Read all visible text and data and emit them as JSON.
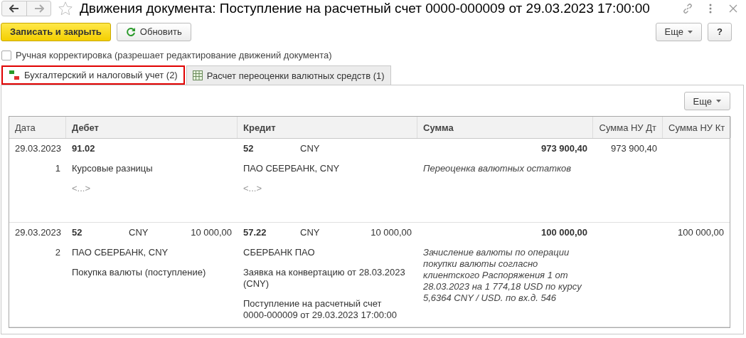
{
  "window": {
    "title": "Движения документа: Поступление на расчетный счет 0000-000009 от 29.03.2023 17:00:00"
  },
  "toolbar": {
    "primary": "Записать и закрыть",
    "refresh": "Обновить",
    "more": "Еще",
    "help": "?"
  },
  "manual_edit": {
    "label": "Ручная корректировка (разрешает редактирование движений документа)",
    "checked": false
  },
  "tabs": [
    {
      "label": "Бухгалтерский и налоговый учет (2)",
      "kind": "ledger",
      "selected": true
    },
    {
      "label": "Расчет переоценки валютных средств (1)",
      "kind": "table",
      "selected": false
    }
  ],
  "panel_more": "Еще",
  "table": {
    "columns": [
      "Дата",
      "Дебет",
      "Кредит",
      "Сумма",
      "Сумма НУ Дт",
      "Сумма НУ Кт"
    ],
    "rows": [
      {
        "date": "29.03.2023",
        "number": "1",
        "debit": {
          "account": "91.02",
          "subconto": [
            {
              "text": "Курсовые разницы",
              "empty": false
            },
            {
              "text": "<...>",
              "empty": true
            }
          ]
        },
        "credit": {
          "account": "52",
          "currency": "CNY",
          "subconto": [
            {
              "text": "ПАО СБЕРБАНК, CNY",
              "empty": false
            },
            {
              "text": "<...>",
              "empty": true
            }
          ]
        },
        "amount": "973 900,40",
        "description": "Переоценка валютных остатков",
        "amount_nu_dt": "973 900,40"
      },
      {
        "date": "29.03.2023",
        "number": "2",
        "debit": {
          "account": "52",
          "currency": "CNY",
          "currency_amount": "10 000,00",
          "subconto": [
            {
              "text": "ПАО СБЕРБАНК, CNY",
              "empty": false
            },
            {
              "text": "Покупка валюты (поступление)",
              "empty": false
            }
          ]
        },
        "credit": {
          "account": "57.22",
          "currency": "CNY",
          "currency_amount": "10 000,00",
          "subconto": [
            {
              "text": "СБЕРБАНК ПАО",
              "empty": false
            },
            {
              "text": "Заявка на конвертацию от 28.03.2023 (CNY)",
              "empty": false
            },
            {
              "text": "Поступление на расчетный счет 0000-000009 от 29.03.2023 17:00:00",
              "empty": false
            }
          ]
        },
        "amount": "100 000,00",
        "description": "Зачисление валюты по операции покупки валюты согласно клиентского Распоряжения 1 от 28.03.2023 на 1 774,18 USD по курсу 5,6364 CNY / USD. по вх.д. 546",
        "amount_nu_kt": "100 000,00"
      }
    ]
  }
}
